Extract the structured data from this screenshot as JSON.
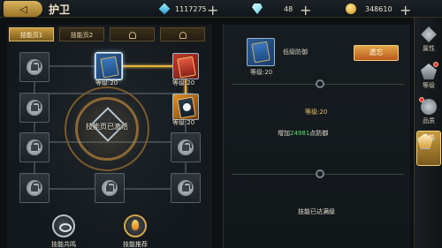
{
  "header": {
    "back_label": "◁",
    "title": "护卫",
    "currencies": [
      {
        "icon": "gem-icon",
        "value": "1117275",
        "plus": "+"
      },
      {
        "icon": "diamond-icon",
        "value": "48",
        "plus": "+"
      },
      {
        "icon": "coin-icon",
        "value": "348610",
        "plus": "+"
      }
    ]
  },
  "tabs": [
    {
      "label": "技能页1",
      "active": true
    },
    {
      "label": "技能页2",
      "active": false
    },
    {
      "label": "",
      "locked": true
    },
    {
      "label": "",
      "locked": true
    }
  ],
  "skills": {
    "s1_level": "等级:20",
    "s2_level": "等级:20",
    "s3_level": "等级:20"
  },
  "emblem": {
    "text": "技能页已激活"
  },
  "bottom_buttons": {
    "resonance": "技能共鸣",
    "recommend": "技能推荐"
  },
  "detail": {
    "name": "低级防御",
    "level": "等级:20",
    "forget_label": "遗忘",
    "current_level": "等级:20",
    "effect_prefix": "增加",
    "effect_value": "24981",
    "effect_suffix": "点防御",
    "maxed_text": "技能已达满级"
  },
  "side_nav": [
    {
      "label": "属性",
      "icon": "attribute-icon"
    },
    {
      "label": "等级",
      "icon": "level-icon"
    },
    {
      "label": "品质",
      "icon": "quality-icon"
    },
    {
      "label": "技能",
      "icon": "skill-icon",
      "active": true
    }
  ]
}
